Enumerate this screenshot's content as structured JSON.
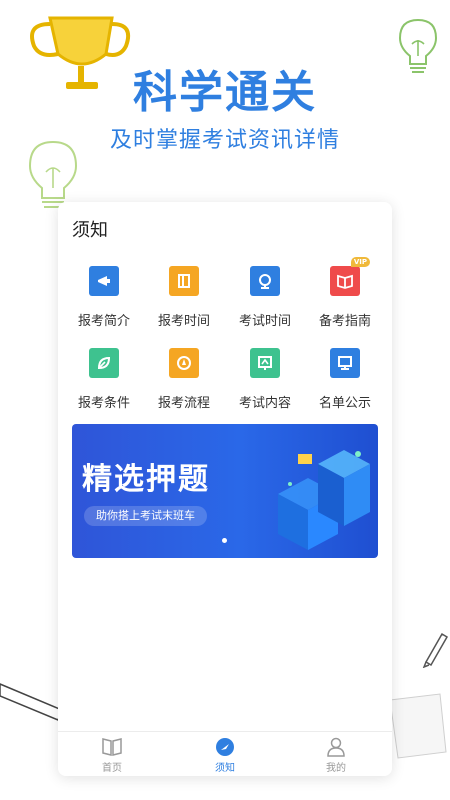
{
  "header": {
    "title": "科学通关",
    "subtitle": "及时掌握考试资讯详情"
  },
  "card": {
    "title": "须知",
    "grid": [
      {
        "label": "报考简介",
        "icon": "megaphone-icon",
        "color": "#2f7fe0"
      },
      {
        "label": "报考时间",
        "icon": "book-icon",
        "color": "#f5a623"
      },
      {
        "label": "考试时间",
        "icon": "globe-icon",
        "color": "#2f7fe0"
      },
      {
        "label": "备考指南",
        "icon": "open-book-icon",
        "color": "#ef4b4b",
        "badge": "VIP"
      },
      {
        "label": "报考条件",
        "icon": "leaf-icon",
        "color": "#3ec28f"
      },
      {
        "label": "报考流程",
        "icon": "compass-icon",
        "color": "#f5a623"
      },
      {
        "label": "考试内容",
        "icon": "chart-board-icon",
        "color": "#3ec28f"
      },
      {
        "label": "名单公示",
        "icon": "monitor-icon",
        "color": "#2f7fe0"
      }
    ],
    "banner": {
      "title": "精选押题",
      "pill": "助你搭上考试末班车"
    }
  },
  "tabbar": [
    {
      "label": "首页",
      "icon": "home-book-icon",
      "active": false
    },
    {
      "label": "须知",
      "icon": "compass-icon",
      "active": true
    },
    {
      "label": "我的",
      "icon": "person-icon",
      "active": false
    }
  ],
  "colors": {
    "accent": "#2f7fe0",
    "tab_active": "#2f7fe0",
    "tab_inactive": "#999999"
  }
}
